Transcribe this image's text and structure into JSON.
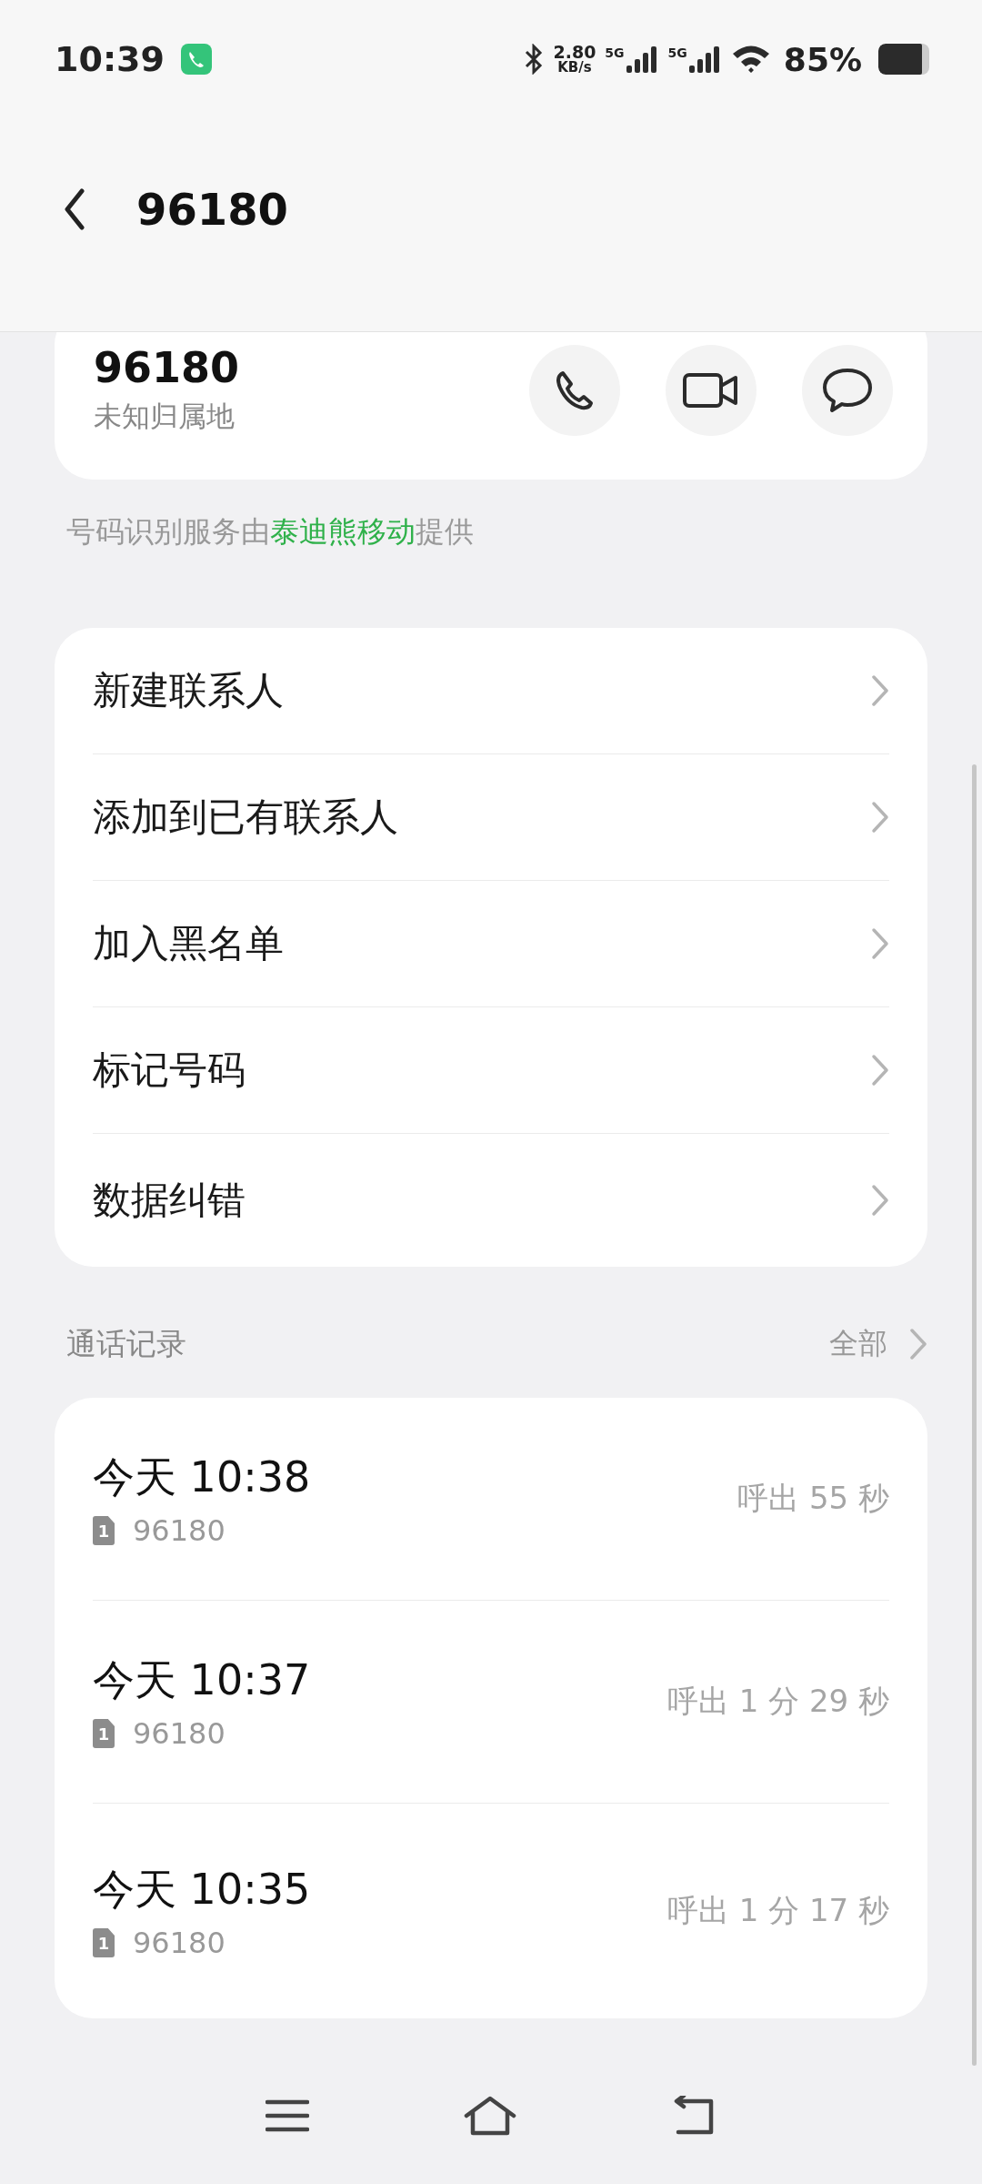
{
  "status_bar": {
    "time": "10:39",
    "speed_value": "2.80",
    "speed_unit": "KB/s",
    "sim_labels": [
      "5G",
      "5G"
    ],
    "battery": "85%"
  },
  "header": {
    "title": "96180"
  },
  "contact_card": {
    "number": "96180",
    "location": "未知归属地"
  },
  "provider_note": {
    "prefix": "号码识别服务由",
    "provider": "泰迪熊移动",
    "suffix": "提供"
  },
  "actions": [
    {
      "label": "新建联系人"
    },
    {
      "label": "添加到已有联系人"
    },
    {
      "label": "加入黑名单"
    },
    {
      "label": "标记号码"
    },
    {
      "label": "数据纠错"
    }
  ],
  "call_log": {
    "title": "通话记录",
    "all_link": "全部",
    "entries": [
      {
        "time": "今天 10:38",
        "sim": "1",
        "number": "96180",
        "detail": "呼出 55 秒"
      },
      {
        "time": "今天 10:37",
        "sim": "1",
        "number": "96180",
        "detail": "呼出 1 分 29 秒"
      },
      {
        "time": "今天 10:35",
        "sim": "1",
        "number": "96180",
        "detail": "呼出 1 分 17 秒"
      }
    ]
  }
}
